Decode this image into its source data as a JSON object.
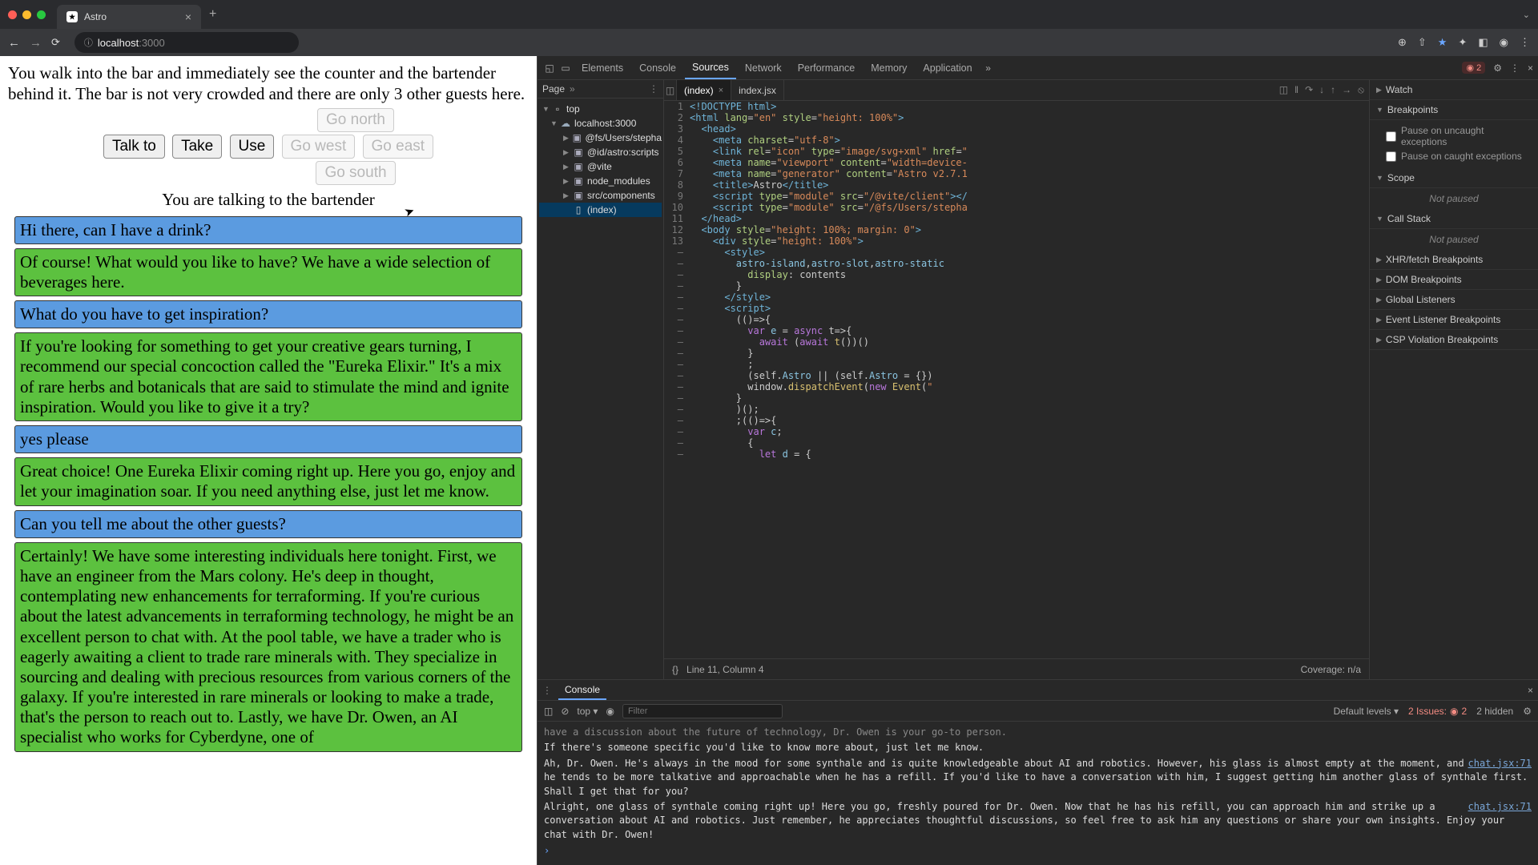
{
  "browser": {
    "tab_title": "Astro",
    "url_host": "localhost",
    "url_port": ":3000"
  },
  "game": {
    "room_desc": "You walk into the bar and immediately see the counter and the bartender behind it. The bar is not very crowded and there are only 3 other guests here.",
    "btn_talk": "Talk to",
    "btn_take": "Take",
    "btn_use": "Use",
    "btn_north": "Go north",
    "btn_west": "Go west",
    "btn_east": "Go east",
    "btn_south": "Go south",
    "talking_to": "You are talking to the bartender",
    "messages": [
      {
        "role": "user",
        "text": "Hi there, can I have a drink?"
      },
      {
        "role": "bot",
        "text": "Of course! What would you like to have? We have a wide selection of beverages here."
      },
      {
        "role": "user",
        "text": "What do you have to get inspiration?"
      },
      {
        "role": "bot",
        "text": "If you're looking for something to get your creative gears turning, I recommend our special concoction called the \"Eureka Elixir.\" It's a mix of rare herbs and botanicals that are said to stimulate the mind and ignite inspiration. Would you like to give it a try?"
      },
      {
        "role": "user",
        "text": "yes please"
      },
      {
        "role": "bot",
        "text": "Great choice! One Eureka Elixir coming right up. Here you go, enjoy and let your imagination soar. If you need anything else, just let me know."
      },
      {
        "role": "user",
        "text": "Can you tell me about the other guests?"
      },
      {
        "role": "bot",
        "text": "Certainly! We have some interesting individuals here tonight. First, we have an engineer from the Mars colony. He's deep in thought, contemplating new enhancements for terraforming. If you're curious about the latest advancements in terraforming technology, he might be an excellent person to chat with. At the pool table, we have a trader who is eagerly awaiting a client to trade rare minerals with. They specialize in sourcing and dealing with precious resources from various corners of the galaxy. If you're interested in rare minerals or looking to make a trade, that's the person to reach out to. Lastly, we have Dr. Owen, an AI specialist who works for Cyberdyne, one of"
      }
    ]
  },
  "devtools": {
    "tabs": [
      "Elements",
      "Console",
      "Sources",
      "Network",
      "Performance",
      "Memory",
      "Application"
    ],
    "active_tab": "Sources",
    "error_count": "2",
    "nav_header": "Page",
    "tree": {
      "top": "top",
      "origin": "localhost:3000",
      "folders": [
        "@fs/Users/stepha",
        "@id/astro:scripts",
        "@vite",
        "node_modules",
        "src/components"
      ],
      "file_index": "(index)"
    },
    "editor_tabs": {
      "active": "(index)",
      "other": "index.jsx"
    },
    "status": {
      "pos": "Line 11, Column 4",
      "coverage": "Coverage: n/a"
    },
    "debug": {
      "watch": "Watch",
      "breakpoints": "Breakpoints",
      "bp_uncaught": "Pause on uncaught exceptions",
      "bp_caught": "Pause on caught exceptions",
      "scope": "Scope",
      "not_paused": "Not paused",
      "callstack": "Call Stack",
      "xhr": "XHR/fetch Breakpoints",
      "dom": "DOM Breakpoints",
      "global": "Global Listeners",
      "event": "Event Listener Breakpoints",
      "csp": "CSP Violation Breakpoints"
    }
  },
  "console": {
    "tab": "Console",
    "context": "top",
    "filter_placeholder": "Filter",
    "levels": "Default levels",
    "issues": "2 Issues:",
    "issues_count": "2",
    "hidden": "2 hidden",
    "entries": [
      {
        "text": "have a discussion about the future of technology, Dr. Owen is your go-to person.",
        "faded": true
      },
      {
        "text": "If there's someone specific you'd like to know more about, just let me know."
      },
      {
        "text": "Ah, Dr. Owen. He's always in the mood for some synthale and is quite knowledgeable about AI and robotics. However, his glass is almost empty at the moment, and he tends to be more talkative and approachable when he has a refill. If you'd like to have a conversation with him, I suggest getting him another glass of synthale first. Shall I get that for you?",
        "src": "chat.jsx:71"
      },
      {
        "text": "Alright, one glass of synthale coming right up! Here you go, freshly poured for Dr. Owen. Now that he has his refill, you can approach him and strike up a conversation about AI and robotics. Just remember, he appreciates thoughtful discussions, so feel free to ask him any questions or share your own insights. Enjoy your chat with Dr. Owen!",
        "src": "chat.jsx:71"
      }
    ]
  },
  "code_lines": [
    {
      "n": "1",
      "html": "<span class='tok-tag'>&lt;!DOCTYPE html&gt;</span>"
    },
    {
      "n": "2",
      "html": "<span class='tok-tag'>&lt;html</span> <span class='tok-attr'>lang</span>=<span class='tok-str'>\"en\"</span> <span class='tok-attr'>style</span>=<span class='tok-str'>\"height: 100%\"</span><span class='tok-tag'>&gt;</span>"
    },
    {
      "n": "3",
      "html": "  <span class='tok-tag'>&lt;head&gt;</span>"
    },
    {
      "n": "4",
      "html": "    <span class='tok-tag'>&lt;meta</span> <span class='tok-attr'>charset</span>=<span class='tok-str'>\"utf-8\"</span><span class='tok-tag'>&gt;</span>"
    },
    {
      "n": "5",
      "html": "    <span class='tok-tag'>&lt;link</span> <span class='tok-attr'>rel</span>=<span class='tok-str'>\"icon\"</span> <span class='tok-attr'>type</span>=<span class='tok-str'>\"image/svg+xml\"</span> <span class='tok-attr'>href</span>=<span class='tok-str'>\"</span>"
    },
    {
      "n": "6",
      "html": "    <span class='tok-tag'>&lt;meta</span> <span class='tok-attr'>name</span>=<span class='tok-str'>\"viewport\"</span> <span class='tok-attr'>content</span>=<span class='tok-str'>\"width=device-</span>"
    },
    {
      "n": "7",
      "html": "    <span class='tok-tag'>&lt;meta</span> <span class='tok-attr'>name</span>=<span class='tok-str'>\"generator\"</span> <span class='tok-attr'>content</span>=<span class='tok-str'>\"Astro v2.7.1</span>"
    },
    {
      "n": "8",
      "html": "    <span class='tok-tag'>&lt;title&gt;</span>Astro<span class='tok-tag'>&lt;/title&gt;</span>"
    },
    {
      "n": "9",
      "html": "    <span class='tok-tag'>&lt;script</span> <span class='tok-attr'>type</span>=<span class='tok-str'>\"module\"</span> <span class='tok-attr'>src</span>=<span class='tok-str'>\"/@vite/client\"</span><span class='tok-tag'>&gt;&lt;/</span>"
    },
    {
      "n": "10",
      "html": "    <span class='tok-tag'>&lt;script</span> <span class='tok-attr'>type</span>=<span class='tok-str'>\"module\"</span> <span class='tok-attr'>src</span>=<span class='tok-str'>\"/@fs/Users/stepha</span>"
    },
    {
      "n": "11",
      "html": "  <span class='tok-tag'>&lt;/head&gt;</span>"
    },
    {
      "n": "12",
      "html": "  <span class='tok-tag'>&lt;body</span> <span class='tok-attr'>style</span>=<span class='tok-str'>\"height: 100%; margin: 0\"</span><span class='tok-tag'>&gt;</span>"
    },
    {
      "n": "13",
      "html": "    <span class='tok-tag'>&lt;div</span> <span class='tok-attr'>style</span>=<span class='tok-str'>\"height: 100%\"</span><span class='tok-tag'>&gt;</span>"
    },
    {
      "n": "–",
      "html": "      <span class='tok-tag'>&lt;style&gt;</span>"
    },
    {
      "n": "–",
      "html": "        <span class='tok-var'>astro-island</span>,<span class='tok-var'>astro-slot</span>,<span class='tok-var'>astro-static</span>"
    },
    {
      "n": "–",
      "html": "          <span class='tok-attr'>display</span>: contents"
    },
    {
      "n": "–",
      "html": "        }"
    },
    {
      "n": "–",
      "html": "      <span class='tok-tag'>&lt;/style&gt;</span>"
    },
    {
      "n": "–",
      "html": "      <span class='tok-tag'>&lt;script&gt;</span>"
    },
    {
      "n": "–",
      "html": "        (()=&gt;{"
    },
    {
      "n": "–",
      "html": "          <span class='tok-kw'>var</span> <span class='tok-var'>e</span> = <span class='tok-kw'>async</span> t=&gt;{"
    },
    {
      "n": "–",
      "html": "            <span class='tok-kw'>await</span> (<span class='tok-kw'>await</span> <span class='tok-fn'>t</span>())()"
    },
    {
      "n": "–",
      "html": "          }"
    },
    {
      "n": "–",
      "html": "          ;"
    },
    {
      "n": "–",
      "html": "          (self.<span class='tok-var'>Astro</span> || (self.<span class='tok-var'>Astro</span> = {})"
    },
    {
      "n": "–",
      "html": "          window.<span class='tok-fn'>dispatchEvent</span>(<span class='tok-kw'>new</span> <span class='tok-fn'>Event</span>(<span class='tok-str'>\"</span>"
    },
    {
      "n": "–",
      "html": "        }"
    },
    {
      "n": "–",
      "html": "        )();"
    },
    {
      "n": "–",
      "html": "        ;(()=&gt;{"
    },
    {
      "n": "–",
      "html": "          <span class='tok-kw'>var</span> <span class='tok-var'>c</span>;"
    },
    {
      "n": "–",
      "html": "          {"
    },
    {
      "n": "–",
      "html": "            <span class='tok-kw'>let</span> <span class='tok-var'>d</span> = {"
    }
  ]
}
